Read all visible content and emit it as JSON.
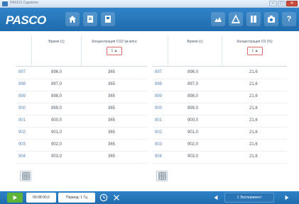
{
  "window": {
    "title": "PASCO Capstone",
    "buttons": [
      "–",
      "□",
      "✕"
    ]
  },
  "toolbar": {
    "logo": "PASCO",
    "icons": [
      "home-icon",
      "document-icon",
      "page-icon",
      "sensor-icon",
      "graph-icon",
      "book-icon",
      "camera-icon",
      "help-icon"
    ],
    "help_label": "?"
  },
  "left_table": {
    "headers": [
      "Время (с)",
      "Концентрация CO2 (м.млн)"
    ],
    "unit_box": "1 ▲",
    "rows": [
      {
        "idx": "897",
        "time": "896,0",
        "value": "365"
      },
      {
        "idx": "898",
        "time": "897,0",
        "value": "365"
      },
      {
        "idx": "899",
        "time": "898,0",
        "value": "365"
      },
      {
        "idx": "900",
        "time": "899,0",
        "value": "365"
      },
      {
        "idx": "901",
        "time": "900,0",
        "value": "365"
      },
      {
        "idx": "902",
        "time": "901,0",
        "value": "365"
      },
      {
        "idx": "903",
        "time": "902,0",
        "value": "365"
      },
      {
        "idx": "904",
        "time": "903,0",
        "value": "365"
      }
    ]
  },
  "right_table": {
    "headers": [
      "Время (с)",
      "Концентрация O2 (%)"
    ],
    "unit_box": "1 ▲",
    "rows": [
      {
        "idx": "897",
        "time": "896,0",
        "value": "21,6"
      },
      {
        "idx": "898",
        "time": "897,0",
        "value": "21,6"
      },
      {
        "idx": "899",
        "time": "898,0",
        "value": "21,6"
      },
      {
        "idx": "900",
        "time": "899,0",
        "value": "21,6"
      },
      {
        "idx": "901",
        "time": "900,0",
        "value": "21,6"
      },
      {
        "idx": "902",
        "time": "901,0",
        "value": "21,6"
      },
      {
        "idx": "903",
        "time": "902,0",
        "value": "21,6"
      },
      {
        "idx": "904",
        "time": "903,0",
        "value": "21,6"
      }
    ]
  },
  "bottombar": {
    "time": "00:08:00,0",
    "period": "Период: 1 Гц",
    "run": "1 Эксперимент"
  },
  "colors": {
    "toolbar_blue": "#2478bd",
    "play_green": "#5fb336",
    "index_blue": "#5b86b8",
    "unit_box_red": "#d96a6a"
  }
}
